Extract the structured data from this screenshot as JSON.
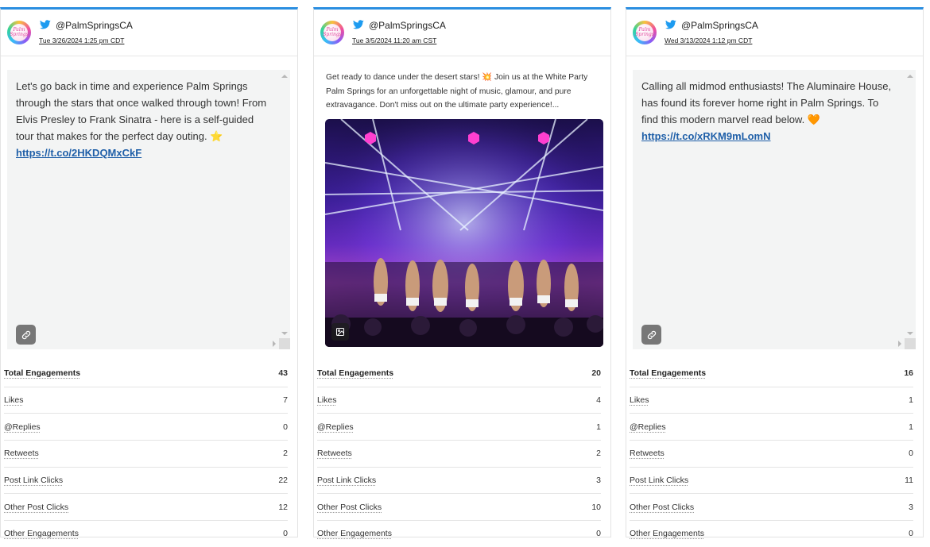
{
  "posts": [
    {
      "handle": "@PalmSpringsCA",
      "date": "Tue 3/26/2024 1:25 pm CDT",
      "avatar_text": "Palm Springs",
      "text": "Let's go back in time and experience Palm Springs through the stars that once walked through town! From Elvis Presley to Frank Sinatra - here is a self-guided tour that makes for the perfect day outing.",
      "emoji": "⭐",
      "link": "https://t.co/2HKDQMxCkF",
      "media": "link-icon",
      "metrics": [
        {
          "label": "Total Engagements",
          "value": "43"
        },
        {
          "label": "Likes",
          "value": "7"
        },
        {
          "label": "@Replies",
          "value": "0"
        },
        {
          "label": "Retweets",
          "value": "2"
        },
        {
          "label": "Post Link Clicks",
          "value": "22"
        },
        {
          "label": "Other Post Clicks",
          "value": "12"
        },
        {
          "label": "Other Engagements",
          "value": "0"
        }
      ]
    },
    {
      "handle": "@PalmSpringsCA",
      "date": "Tue 3/5/2024 11:20 am CST",
      "avatar_text": "Palm Springs",
      "text": "Get ready to dance under the desert stars! 💥 Join us at the White Party Palm Springs for an unforgettable night of music, glamour, and pure extravagance. Don't miss out on the ultimate party experience!...",
      "media": "image-icon",
      "metrics": [
        {
          "label": "Total Engagements",
          "value": "20"
        },
        {
          "label": "Likes",
          "value": "4"
        },
        {
          "label": "@Replies",
          "value": "1"
        },
        {
          "label": "Retweets",
          "value": "2"
        },
        {
          "label": "Post Link Clicks",
          "value": "3"
        },
        {
          "label": "Other Post Clicks",
          "value": "10"
        },
        {
          "label": "Other Engagements",
          "value": "0"
        }
      ]
    },
    {
      "handle": "@PalmSpringsCA",
      "date": "Wed 3/13/2024 1:12 pm CDT",
      "avatar_text": "Palm Springs",
      "text": "Calling all midmod enthusiasts! The Aluminaire House, has found its forever home right in Palm Springs. To find this modern marvel read below.",
      "emoji": "🧡",
      "link": "https://t.co/xRKM9mLomN",
      "media": "link-icon",
      "metrics": [
        {
          "label": "Total Engagements",
          "value": "16"
        },
        {
          "label": "Likes",
          "value": "1"
        },
        {
          "label": "@Replies",
          "value": "1"
        },
        {
          "label": "Retweets",
          "value": "0"
        },
        {
          "label": "Post Link Clicks",
          "value": "11"
        },
        {
          "label": "Other Post Clicks",
          "value": "3"
        },
        {
          "label": "Other Engagements",
          "value": "0"
        }
      ]
    }
  ],
  "colors": {
    "accent": "#2b8ee0",
    "twitter": "#1d9bf0",
    "link": "#1f5fa8"
  }
}
